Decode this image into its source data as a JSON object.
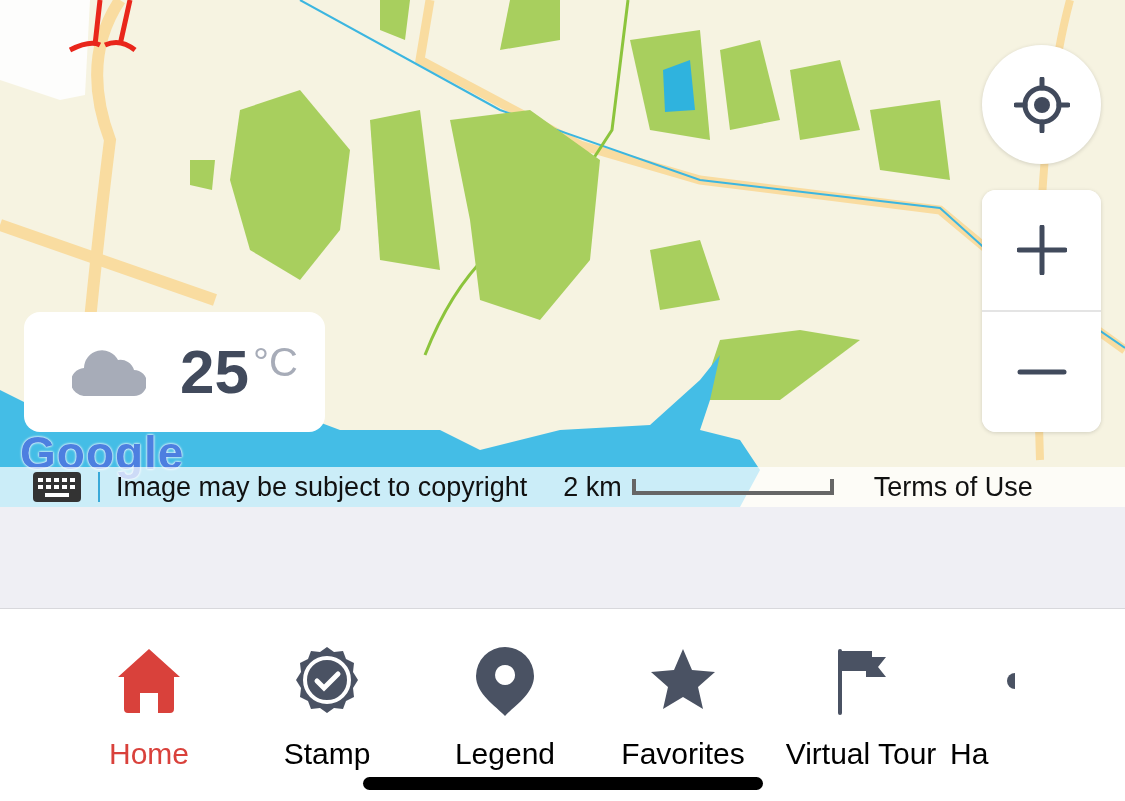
{
  "map": {
    "weather": {
      "temperature": "25",
      "unit": "°C"
    },
    "attribution": {
      "logo": "Google",
      "notice": "Image may be subject to copyright",
      "scale": "2 km",
      "terms": "Terms of Use"
    }
  },
  "tabs": [
    {
      "label": "Home",
      "kind": "home",
      "selected": true
    },
    {
      "label": "Stamp",
      "kind": "stamp",
      "selected": false
    },
    {
      "label": "Legend",
      "kind": "pin",
      "selected": false
    },
    {
      "label": "Favorites",
      "kind": "star",
      "selected": false
    },
    {
      "label": "Virtual Tour",
      "kind": "flag",
      "selected": false
    },
    {
      "label": "Ha",
      "kind": "cut",
      "selected": false
    }
  ]
}
